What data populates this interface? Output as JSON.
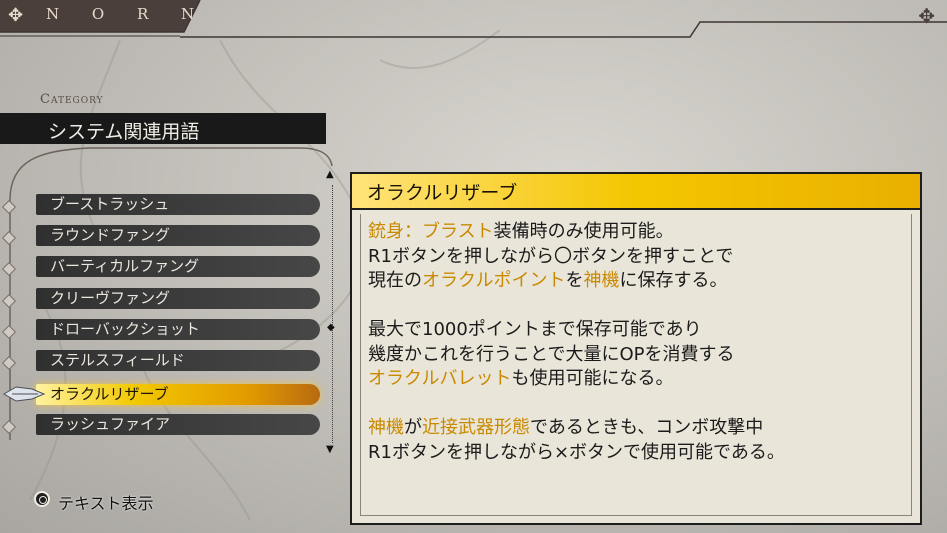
{
  "brand": "N O R N",
  "category": {
    "label": "Category",
    "title": "システム関連用語"
  },
  "list": {
    "items": [
      {
        "label": "ブーストラッシュ"
      },
      {
        "label": "ラウンドファング"
      },
      {
        "label": "バーティカルファング"
      },
      {
        "label": "クリーヴファング"
      },
      {
        "label": "ドローバックショット"
      },
      {
        "label": "ステルスフィールド"
      },
      {
        "label": "オラクルリザーブ"
      },
      {
        "label": "ラッシュファイア"
      }
    ],
    "selected_index": 6
  },
  "detail": {
    "title": "オラクルリザーブ",
    "para1": {
      "l1": {
        "a": "銃身：ブラスト",
        "b": "装備時のみ使用可能。"
      },
      "l2": "R1ボタンを押しながら〇ボタンを押すことで",
      "l3": {
        "a": "現在の",
        "b": "オラクルポイント",
        "c": "を",
        "d": "神機",
        "e": "に保存する。"
      }
    },
    "para2": {
      "l1": "最大で1000ポイントまで保存可能であり",
      "l2": "幾度かこれを行うことで大量にOPを消費する",
      "l3": {
        "a": "オラクルバレット",
        "b": "も使用可能になる。"
      }
    },
    "para3": {
      "l1": {
        "a": "神機",
        "b": "が",
        "c": "近接武器形態",
        "d": "であるときも、コンボ攻撃中"
      },
      "l2": "R1ボタンを押しながら×ボタンで使用可能である。"
    }
  },
  "footer": {
    "button_icon": "circle-button-icon",
    "label": "テキスト表示"
  },
  "colors": {
    "highlight": "#c98a00",
    "title_bar": "#f4c600",
    "dark": "#191919"
  }
}
